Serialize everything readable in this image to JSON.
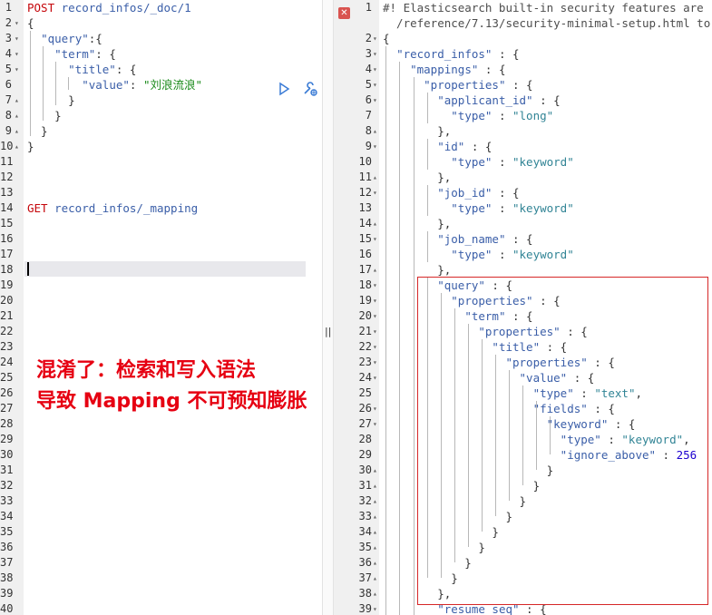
{
  "left_editor": {
    "lines": [
      {
        "n": "1",
        "fold": "",
        "tokens": [
          {
            "t": "POST ",
            "c": "t-method"
          },
          {
            "t": "record_infos/_doc/1",
            "c": "t-url"
          }
        ]
      },
      {
        "n": "2",
        "fold": "▾",
        "tokens": [
          {
            "t": "{",
            "c": "t-punct"
          }
        ]
      },
      {
        "n": "3",
        "fold": "▾",
        "tokens": [
          {
            "t": "  ",
            "c": "t-punct"
          },
          {
            "t": "\"query\"",
            "c": "t-key"
          },
          {
            "t": ":{",
            "c": "t-punct"
          }
        ]
      },
      {
        "n": "4",
        "fold": "▾",
        "tokens": [
          {
            "t": "    ",
            "c": "t-punct"
          },
          {
            "t": "\"term\"",
            "c": "t-key"
          },
          {
            "t": ": {",
            "c": "t-punct"
          }
        ]
      },
      {
        "n": "5",
        "fold": "▾",
        "tokens": [
          {
            "t": "      ",
            "c": "t-punct"
          },
          {
            "t": "\"title\"",
            "c": "t-key"
          },
          {
            "t": ": {",
            "c": "t-punct"
          }
        ]
      },
      {
        "n": "6",
        "fold": "",
        "tokens": [
          {
            "t": "        ",
            "c": "t-punct"
          },
          {
            "t": "\"value\"",
            "c": "t-key"
          },
          {
            "t": ": ",
            "c": "t-punct"
          },
          {
            "t": "\"刘浪流浪\"",
            "c": "t-str-green"
          }
        ]
      },
      {
        "n": "7",
        "fold": "▴",
        "tokens": [
          {
            "t": "      }",
            "c": "t-punct"
          }
        ]
      },
      {
        "n": "8",
        "fold": "▴",
        "tokens": [
          {
            "t": "    }",
            "c": "t-punct"
          }
        ]
      },
      {
        "n": "9",
        "fold": "▴",
        "tokens": [
          {
            "t": "  }",
            "c": "t-punct"
          }
        ]
      },
      {
        "n": "10",
        "fold": "▴",
        "tokens": [
          {
            "t": "}",
            "c": "t-punct"
          }
        ]
      },
      {
        "n": "11",
        "fold": "",
        "tokens": []
      },
      {
        "n": "12",
        "fold": "",
        "tokens": []
      },
      {
        "n": "13",
        "fold": "",
        "tokens": []
      },
      {
        "n": "14",
        "fold": "",
        "tokens": [
          {
            "t": "GET ",
            "c": "t-method"
          },
          {
            "t": "record_infos/_mapping",
            "c": "t-url"
          }
        ]
      },
      {
        "n": "15",
        "fold": "",
        "tokens": []
      },
      {
        "n": "16",
        "fold": "",
        "tokens": []
      },
      {
        "n": "17",
        "fold": "",
        "tokens": []
      },
      {
        "n": "18",
        "fold": "",
        "tokens": []
      },
      {
        "n": "19",
        "fold": "",
        "tokens": []
      },
      {
        "n": "20",
        "fold": "",
        "tokens": []
      },
      {
        "n": "21",
        "fold": "",
        "tokens": []
      },
      {
        "n": "22",
        "fold": "",
        "tokens": []
      },
      {
        "n": "23",
        "fold": "",
        "tokens": []
      },
      {
        "n": "24",
        "fold": "",
        "tokens": []
      },
      {
        "n": "25",
        "fold": "",
        "tokens": []
      },
      {
        "n": "26",
        "fold": "",
        "tokens": []
      },
      {
        "n": "27",
        "fold": "",
        "tokens": []
      },
      {
        "n": "28",
        "fold": "",
        "tokens": []
      },
      {
        "n": "29",
        "fold": "",
        "tokens": []
      },
      {
        "n": "30",
        "fold": "",
        "tokens": []
      },
      {
        "n": "31",
        "fold": "",
        "tokens": []
      },
      {
        "n": "32",
        "fold": "",
        "tokens": []
      },
      {
        "n": "33",
        "fold": "",
        "tokens": []
      },
      {
        "n": "34",
        "fold": "",
        "tokens": []
      },
      {
        "n": "35",
        "fold": "",
        "tokens": []
      },
      {
        "n": "36",
        "fold": "",
        "tokens": []
      },
      {
        "n": "37",
        "fold": "",
        "tokens": []
      },
      {
        "n": "38",
        "fold": "",
        "tokens": []
      },
      {
        "n": "39",
        "fold": "",
        "tokens": []
      },
      {
        "n": "40",
        "fold": "",
        "tokens": []
      }
    ],
    "active_line": "18",
    "run_icon": "play-icon",
    "settings_icon": "wrench-icon"
  },
  "right_editor": {
    "lines": [
      {
        "n": "1",
        "fold": "",
        "tokens": [
          {
            "t": "#! Elasticsearch built-in security features are",
            "c": "t-comment"
          }
        ]
      },
      {
        "n": "",
        "fold": "",
        "tokens": [
          {
            "t": "  /reference/7.13/security-minimal-setup.html to",
            "c": "t-comment"
          }
        ]
      },
      {
        "n": "2",
        "fold": "▾",
        "tokens": [
          {
            "t": "{",
            "c": "t-punct"
          }
        ]
      },
      {
        "n": "3",
        "fold": "▾",
        "tokens": [
          {
            "t": "  ",
            "c": "t-punct"
          },
          {
            "t": "\"record_infos\"",
            "c": "t-key"
          },
          {
            "t": " : {",
            "c": "t-punct"
          }
        ]
      },
      {
        "n": "4",
        "fold": "▾",
        "tokens": [
          {
            "t": "    ",
            "c": "t-punct"
          },
          {
            "t": "\"mappings\"",
            "c": "t-key"
          },
          {
            "t": " : {",
            "c": "t-punct"
          }
        ]
      },
      {
        "n": "5",
        "fold": "▾",
        "tokens": [
          {
            "t": "      ",
            "c": "t-punct"
          },
          {
            "t": "\"properties\"",
            "c": "t-key"
          },
          {
            "t": " : {",
            "c": "t-punct"
          }
        ]
      },
      {
        "n": "6",
        "fold": "▾",
        "tokens": [
          {
            "t": "        ",
            "c": "t-punct"
          },
          {
            "t": "\"applicant_id\"",
            "c": "t-key"
          },
          {
            "t": " : {",
            "c": "t-punct"
          }
        ]
      },
      {
        "n": "7",
        "fold": "",
        "tokens": [
          {
            "t": "          ",
            "c": "t-punct"
          },
          {
            "t": "\"type\"",
            "c": "t-key"
          },
          {
            "t": " : ",
            "c": "t-punct"
          },
          {
            "t": "\"long\"",
            "c": "t-str"
          }
        ]
      },
      {
        "n": "8",
        "fold": "▴",
        "tokens": [
          {
            "t": "        },",
            "c": "t-punct"
          }
        ]
      },
      {
        "n": "9",
        "fold": "▾",
        "tokens": [
          {
            "t": "        ",
            "c": "t-punct"
          },
          {
            "t": "\"id\"",
            "c": "t-key"
          },
          {
            "t": " : {",
            "c": "t-punct"
          }
        ]
      },
      {
        "n": "10",
        "fold": "",
        "tokens": [
          {
            "t": "          ",
            "c": "t-punct"
          },
          {
            "t": "\"type\"",
            "c": "t-key"
          },
          {
            "t": " : ",
            "c": "t-punct"
          },
          {
            "t": "\"keyword\"",
            "c": "t-str"
          }
        ]
      },
      {
        "n": "11",
        "fold": "▴",
        "tokens": [
          {
            "t": "        },",
            "c": "t-punct"
          }
        ]
      },
      {
        "n": "12",
        "fold": "▾",
        "tokens": [
          {
            "t": "        ",
            "c": "t-punct"
          },
          {
            "t": "\"job_id\"",
            "c": "t-key"
          },
          {
            "t": " : {",
            "c": "t-punct"
          }
        ]
      },
      {
        "n": "13",
        "fold": "",
        "tokens": [
          {
            "t": "          ",
            "c": "t-punct"
          },
          {
            "t": "\"type\"",
            "c": "t-key"
          },
          {
            "t": " : ",
            "c": "t-punct"
          },
          {
            "t": "\"keyword\"",
            "c": "t-str"
          }
        ]
      },
      {
        "n": "14",
        "fold": "▴",
        "tokens": [
          {
            "t": "        },",
            "c": "t-punct"
          }
        ]
      },
      {
        "n": "15",
        "fold": "▾",
        "tokens": [
          {
            "t": "        ",
            "c": "t-punct"
          },
          {
            "t": "\"job_name\"",
            "c": "t-key"
          },
          {
            "t": " : {",
            "c": "t-punct"
          }
        ]
      },
      {
        "n": "16",
        "fold": "",
        "tokens": [
          {
            "t": "          ",
            "c": "t-punct"
          },
          {
            "t": "\"type\"",
            "c": "t-key"
          },
          {
            "t": " : ",
            "c": "t-punct"
          },
          {
            "t": "\"keyword\"",
            "c": "t-str"
          }
        ]
      },
      {
        "n": "17",
        "fold": "▴",
        "tokens": [
          {
            "t": "        },",
            "c": "t-punct"
          }
        ]
      },
      {
        "n": "18",
        "fold": "▾",
        "tokens": [
          {
            "t": "        ",
            "c": "t-punct"
          },
          {
            "t": "\"query\"",
            "c": "t-key"
          },
          {
            "t": " : {",
            "c": "t-punct"
          }
        ]
      },
      {
        "n": "19",
        "fold": "▾",
        "tokens": [
          {
            "t": "          ",
            "c": "t-punct"
          },
          {
            "t": "\"properties\"",
            "c": "t-key"
          },
          {
            "t": " : {",
            "c": "t-punct"
          }
        ]
      },
      {
        "n": "20",
        "fold": "▾",
        "tokens": [
          {
            "t": "            ",
            "c": "t-punct"
          },
          {
            "t": "\"term\"",
            "c": "t-key"
          },
          {
            "t": " : {",
            "c": "t-punct"
          }
        ]
      },
      {
        "n": "21",
        "fold": "▾",
        "tokens": [
          {
            "t": "              ",
            "c": "t-punct"
          },
          {
            "t": "\"properties\"",
            "c": "t-key"
          },
          {
            "t": " : {",
            "c": "t-punct"
          }
        ]
      },
      {
        "n": "22",
        "fold": "▾",
        "tokens": [
          {
            "t": "                ",
            "c": "t-punct"
          },
          {
            "t": "\"title\"",
            "c": "t-key"
          },
          {
            "t": " : {",
            "c": "t-punct"
          }
        ]
      },
      {
        "n": "23",
        "fold": "▾",
        "tokens": [
          {
            "t": "                  ",
            "c": "t-punct"
          },
          {
            "t": "\"properties\"",
            "c": "t-key"
          },
          {
            "t": " : {",
            "c": "t-punct"
          }
        ]
      },
      {
        "n": "24",
        "fold": "▾",
        "tokens": [
          {
            "t": "                    ",
            "c": "t-punct"
          },
          {
            "t": "\"value\"",
            "c": "t-key"
          },
          {
            "t": " : {",
            "c": "t-punct"
          }
        ]
      },
      {
        "n": "25",
        "fold": "",
        "tokens": [
          {
            "t": "                      ",
            "c": "t-punct"
          },
          {
            "t": "\"type\"",
            "c": "t-key"
          },
          {
            "t": " : ",
            "c": "t-punct"
          },
          {
            "t": "\"text\"",
            "c": "t-str"
          },
          {
            "t": ",",
            "c": "t-punct"
          }
        ]
      },
      {
        "n": "26",
        "fold": "▾",
        "tokens": [
          {
            "t": "                      ",
            "c": "t-punct"
          },
          {
            "t": "\"fields\"",
            "c": "t-key"
          },
          {
            "t": " : {",
            "c": "t-punct"
          }
        ]
      },
      {
        "n": "27",
        "fold": "▾",
        "tokens": [
          {
            "t": "                        ",
            "c": "t-punct"
          },
          {
            "t": "\"keyword\"",
            "c": "t-key"
          },
          {
            "t": " : {",
            "c": "t-punct"
          }
        ]
      },
      {
        "n": "28",
        "fold": "",
        "tokens": [
          {
            "t": "                          ",
            "c": "t-punct"
          },
          {
            "t": "\"type\"",
            "c": "t-key"
          },
          {
            "t": " : ",
            "c": "t-punct"
          },
          {
            "t": "\"keyword\"",
            "c": "t-str"
          },
          {
            "t": ",",
            "c": "t-punct"
          }
        ]
      },
      {
        "n": "29",
        "fold": "",
        "tokens": [
          {
            "t": "                          ",
            "c": "t-punct"
          },
          {
            "t": "\"ignore_above\"",
            "c": "t-key"
          },
          {
            "t": " : ",
            "c": "t-punct"
          },
          {
            "t": "256",
            "c": "t-num"
          }
        ]
      },
      {
        "n": "30",
        "fold": "▴",
        "tokens": [
          {
            "t": "                        }",
            "c": "t-punct"
          }
        ]
      },
      {
        "n": "31",
        "fold": "▴",
        "tokens": [
          {
            "t": "                      }",
            "c": "t-punct"
          }
        ]
      },
      {
        "n": "32",
        "fold": "▴",
        "tokens": [
          {
            "t": "                    }",
            "c": "t-punct"
          }
        ]
      },
      {
        "n": "33",
        "fold": "▴",
        "tokens": [
          {
            "t": "                  }",
            "c": "t-punct"
          }
        ]
      },
      {
        "n": "34",
        "fold": "▴",
        "tokens": [
          {
            "t": "                }",
            "c": "t-punct"
          }
        ]
      },
      {
        "n": "35",
        "fold": "▴",
        "tokens": [
          {
            "t": "              }",
            "c": "t-punct"
          }
        ]
      },
      {
        "n": "36",
        "fold": "▴",
        "tokens": [
          {
            "t": "            }",
            "c": "t-punct"
          }
        ]
      },
      {
        "n": "37",
        "fold": "▴",
        "tokens": [
          {
            "t": "          }",
            "c": "t-punct"
          }
        ]
      },
      {
        "n": "38",
        "fold": "▴",
        "tokens": [
          {
            "t": "        },",
            "c": "t-punct"
          }
        ]
      },
      {
        "n": "39",
        "fold": "▾",
        "tokens": [
          {
            "t": "        ",
            "c": "t-punct"
          },
          {
            "t": "\"resume_seq\"",
            "c": "t-key"
          },
          {
            "t": " : {",
            "c": "t-punct"
          }
        ]
      }
    ],
    "error_icon": "error-x-icon"
  },
  "divider": {
    "grip": "||"
  },
  "annotation": {
    "line1": "混淆了：检索和写入语法",
    "line2": "导致 Mapping 不可预知膨胀",
    "color": "#e60012"
  },
  "highlight_box_color": "#d62728"
}
